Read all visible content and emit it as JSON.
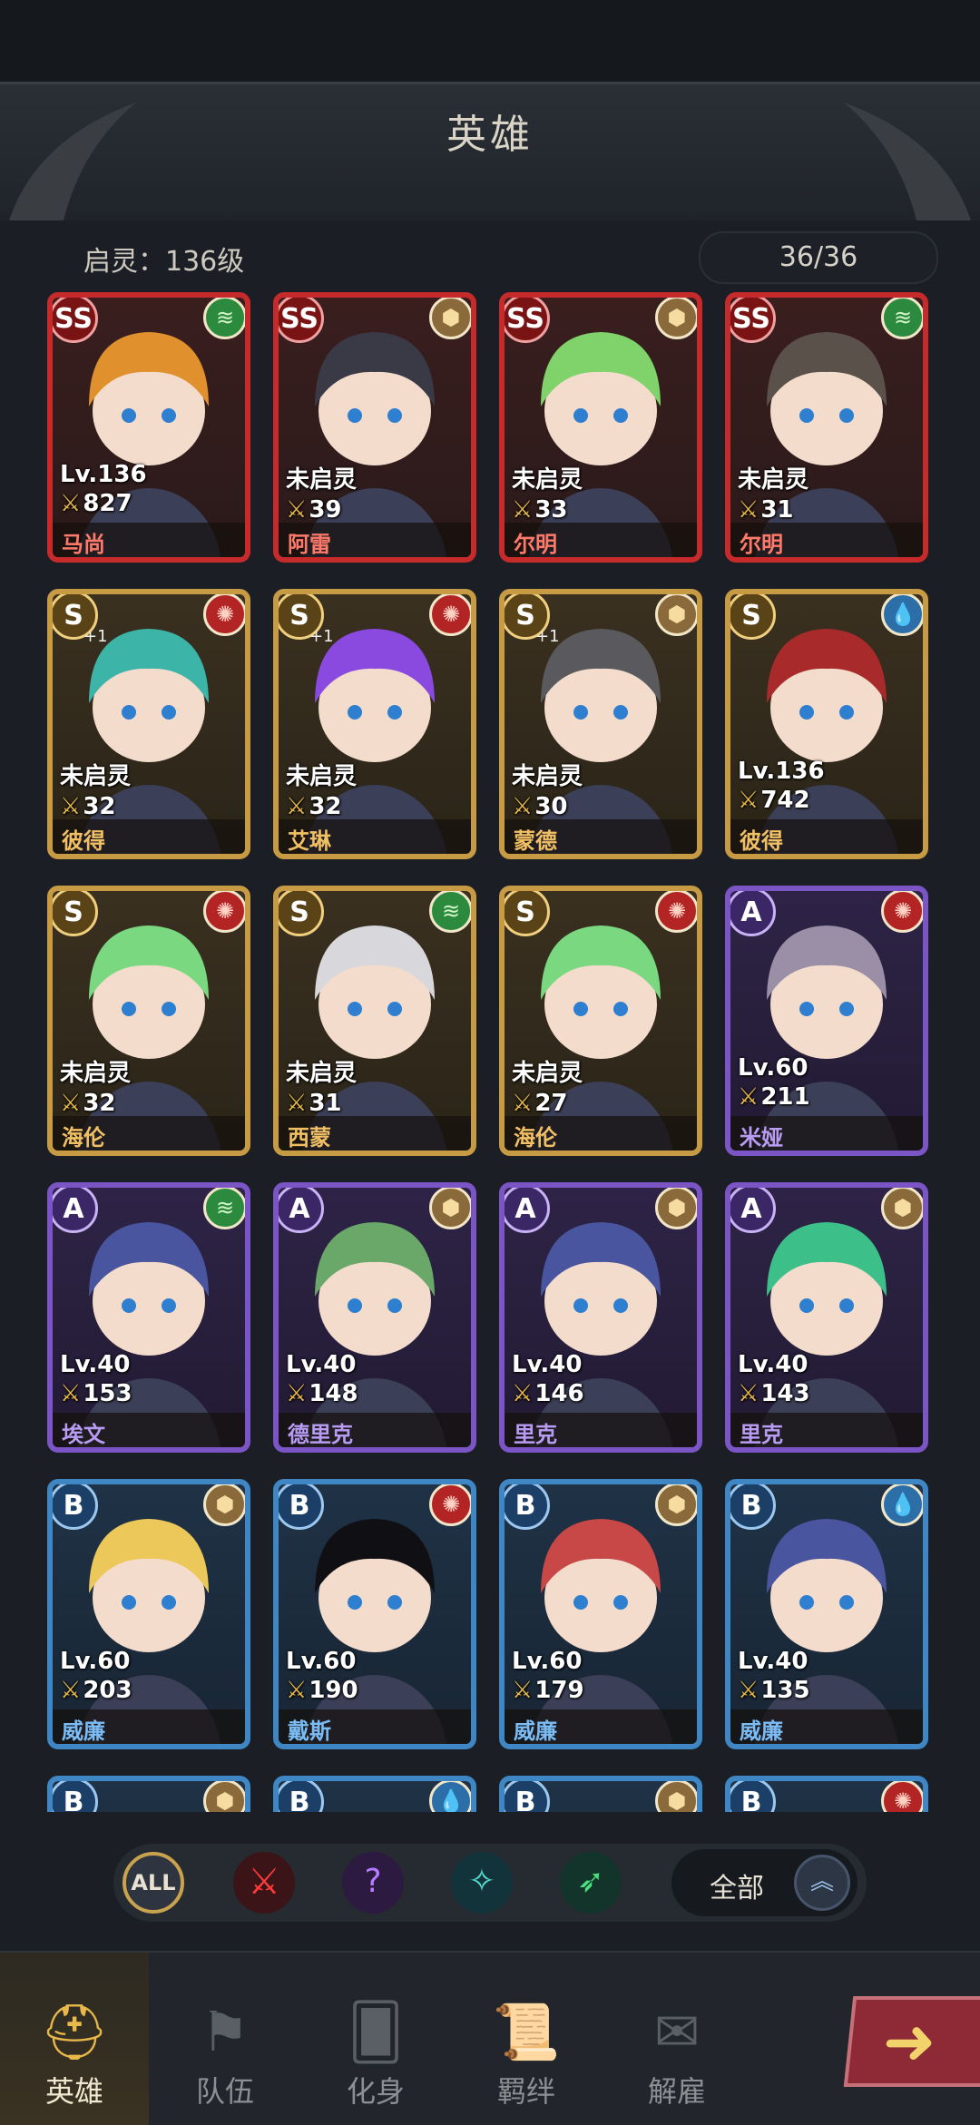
{
  "page": {
    "title": "英雄"
  },
  "stats": {
    "level_text": "启灵：136级",
    "count_text": "36/36"
  },
  "heroes": [
    {
      "rank": "SS",
      "element": "wind",
      "lv": "Lv.136",
      "power": "827",
      "name": "马尚",
      "hair": "#e0902c",
      "plus": ""
    },
    {
      "rank": "SS",
      "element": "earth",
      "lv": "未启灵",
      "power": "39",
      "name": "阿雷",
      "hair": "#3a3a46",
      "plus": ""
    },
    {
      "rank": "SS",
      "element": "earth",
      "lv": "未启灵",
      "power": "33",
      "name": "尔明",
      "hair": "#7fd36a",
      "plus": ""
    },
    {
      "rank": "SS",
      "element": "wind",
      "lv": "未启灵",
      "power": "31",
      "name": "尔明",
      "hair": "#5a524a",
      "plus": ""
    },
    {
      "rank": "S",
      "element": "fire",
      "lv": "未启灵",
      "power": "32",
      "name": "彼得",
      "hair": "#3cb4a8",
      "plus": "+1"
    },
    {
      "rank": "S",
      "element": "fire",
      "lv": "未启灵",
      "power": "32",
      "name": "艾琳",
      "hair": "#8a4ae0",
      "plus": "+1"
    },
    {
      "rank": "S",
      "element": "earth",
      "lv": "未启灵",
      "power": "30",
      "name": "蒙德",
      "hair": "#5a5a5e",
      "plus": "+1"
    },
    {
      "rank": "S",
      "element": "water",
      "lv": "Lv.136",
      "power": "742",
      "name": "彼得",
      "hair": "#a82a2a",
      "plus": ""
    },
    {
      "rank": "S",
      "element": "fire",
      "lv": "未启灵",
      "power": "32",
      "name": "海伦",
      "hair": "#7ad880",
      "plus": ""
    },
    {
      "rank": "S",
      "element": "wind",
      "lv": "未启灵",
      "power": "31",
      "name": "西蒙",
      "hair": "#d8d8dc",
      "plus": ""
    },
    {
      "rank": "S",
      "element": "fire",
      "lv": "未启灵",
      "power": "27",
      "name": "海伦",
      "hair": "#7ad880",
      "plus": ""
    },
    {
      "rank": "A",
      "element": "fire",
      "lv": "Lv.60",
      "power": "211",
      "name": "米娅",
      "hair": "#9a8fa6",
      "plus": ""
    },
    {
      "rank": "A",
      "element": "wind",
      "lv": "Lv.40",
      "power": "153",
      "name": "埃文",
      "hair": "#4a55a0",
      "plus": ""
    },
    {
      "rank": "A",
      "element": "earth",
      "lv": "Lv.40",
      "power": "148",
      "name": "德里克",
      "hair": "#6aa86a",
      "plus": ""
    },
    {
      "rank": "A",
      "element": "earth",
      "lv": "Lv.40",
      "power": "146",
      "name": "里克",
      "hair": "#4a55a0",
      "plus": ""
    },
    {
      "rank": "A",
      "element": "earth",
      "lv": "Lv.40",
      "power": "143",
      "name": "里克",
      "hair": "#3cbf88",
      "plus": ""
    },
    {
      "rank": "B",
      "element": "earth",
      "lv": "Lv.60",
      "power": "203",
      "name": "威廉",
      "hair": "#ecc85a",
      "plus": ""
    },
    {
      "rank": "B",
      "element": "fire",
      "lv": "Lv.60",
      "power": "190",
      "name": "戴斯",
      "hair": "#101014",
      "plus": ""
    },
    {
      "rank": "B",
      "element": "earth",
      "lv": "Lv.60",
      "power": "179",
      "name": "威廉",
      "hair": "#c84848",
      "plus": ""
    },
    {
      "rank": "B",
      "element": "water",
      "lv": "Lv.40",
      "power": "135",
      "name": "威廉",
      "hair": "#4a55a0",
      "plus": ""
    },
    {
      "rank": "B",
      "element": "earth",
      "lv": "",
      "power": "",
      "name": "",
      "hair": "#e8e8e8",
      "plus": ""
    },
    {
      "rank": "B",
      "element": "water",
      "lv": "",
      "power": "",
      "name": "",
      "hair": "#3cb4a8",
      "plus": ""
    },
    {
      "rank": "B",
      "element": "earth",
      "lv": "",
      "power": "",
      "name": "",
      "hair": "#e0902c",
      "plus": ""
    },
    {
      "rank": "B",
      "element": "fire",
      "lv": "",
      "power": "",
      "name": "",
      "hair": "#101014",
      "plus": ""
    }
  ],
  "filter": {
    "all_label": "ALL",
    "sort_label": "全部"
  },
  "nav": {
    "tabs": [
      {
        "label": "英雄",
        "icon": "helmet-icon",
        "active": true
      },
      {
        "label": "队伍",
        "icon": "banner-icon",
        "active": false
      },
      {
        "label": "化身",
        "icon": "cards-icon",
        "active": false
      },
      {
        "label": "羁绊",
        "icon": "scroll-icon",
        "active": false
      },
      {
        "label": "解雇",
        "icon": "dismiss-icon",
        "active": false
      }
    ]
  },
  "colors": {
    "ss": "#c72a2a",
    "s": "#c79a44",
    "a": "#7b55c6",
    "b": "#3f86c4",
    "accent": "#e8b94a"
  }
}
